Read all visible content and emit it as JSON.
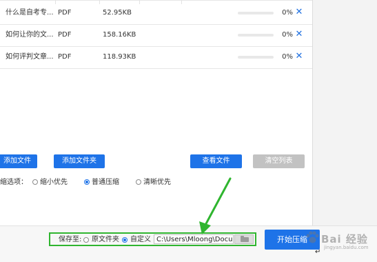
{
  "files": [
    {
      "name": "什么是自考专...",
      "type": "PDF",
      "size": "52.95KB",
      "progress": "0%",
      "progress_value": 0
    },
    {
      "name": "如何让你的文...",
      "type": "PDF",
      "size": "158.16KB",
      "progress": "0%",
      "progress_value": 0
    },
    {
      "name": "如何评判文章...",
      "type": "PDF",
      "size": "118.93KB",
      "progress": "0%",
      "progress_value": 0
    }
  ],
  "row_delete_icon": "close-icon",
  "toolbar": {
    "add_file": "添加文件",
    "add_folder": "添加文件夹",
    "view_file": "查看文件",
    "clear_list": "清空列表"
  },
  "compression": {
    "label": "缩选项：",
    "options": [
      "缩小优先",
      "普通压缩",
      "清晰优先"
    ],
    "selected": "普通压缩"
  },
  "save": {
    "label": "保存至:",
    "option_original": "原文件夹",
    "option_custom": "自定义",
    "selected": "自定义",
    "path": "C:\\Users\\Mloong\\Documents",
    "folder_icon": "folder-icon"
  },
  "start_button": "开始压缩",
  "watermark": {
    "text": "Bai 经验",
    "sub": "jingyan.baidu.com"
  },
  "colors": {
    "accent": "#1e73e8",
    "progress_track": "#e8e8e8",
    "highlight_box": "#2fb52f",
    "arrow": "#2fb52f",
    "disabled_button": "#c2c2c2"
  }
}
